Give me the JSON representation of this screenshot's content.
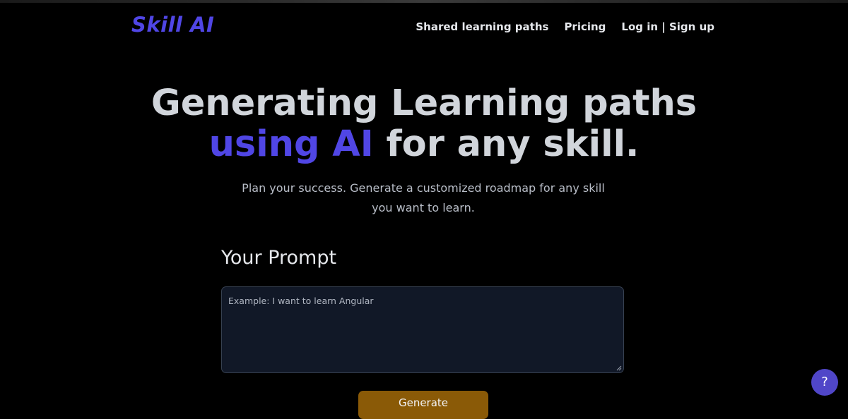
{
  "brand": {
    "name": "Skill AI"
  },
  "nav": {
    "shared_paths": "Shared learning paths",
    "pricing": "Pricing",
    "auth": "Log in | Sign up"
  },
  "hero": {
    "title_line1": "Generating Learning paths",
    "title_accent": "using AI",
    "title_rest": " for any skill.",
    "subtitle": "Plan your success. Generate a customized roadmap for any skill you want to learn."
  },
  "prompt": {
    "label": "Your Prompt",
    "placeholder": "Example: I want to learn Angular",
    "value": ""
  },
  "generate": {
    "label": "Generate"
  },
  "help": {
    "label": "?"
  },
  "colors": {
    "accent": "#5046e5",
    "background": "#000000",
    "input_bg": "#111827",
    "button": "#8a5a07",
    "help_button": "#5046c8"
  }
}
